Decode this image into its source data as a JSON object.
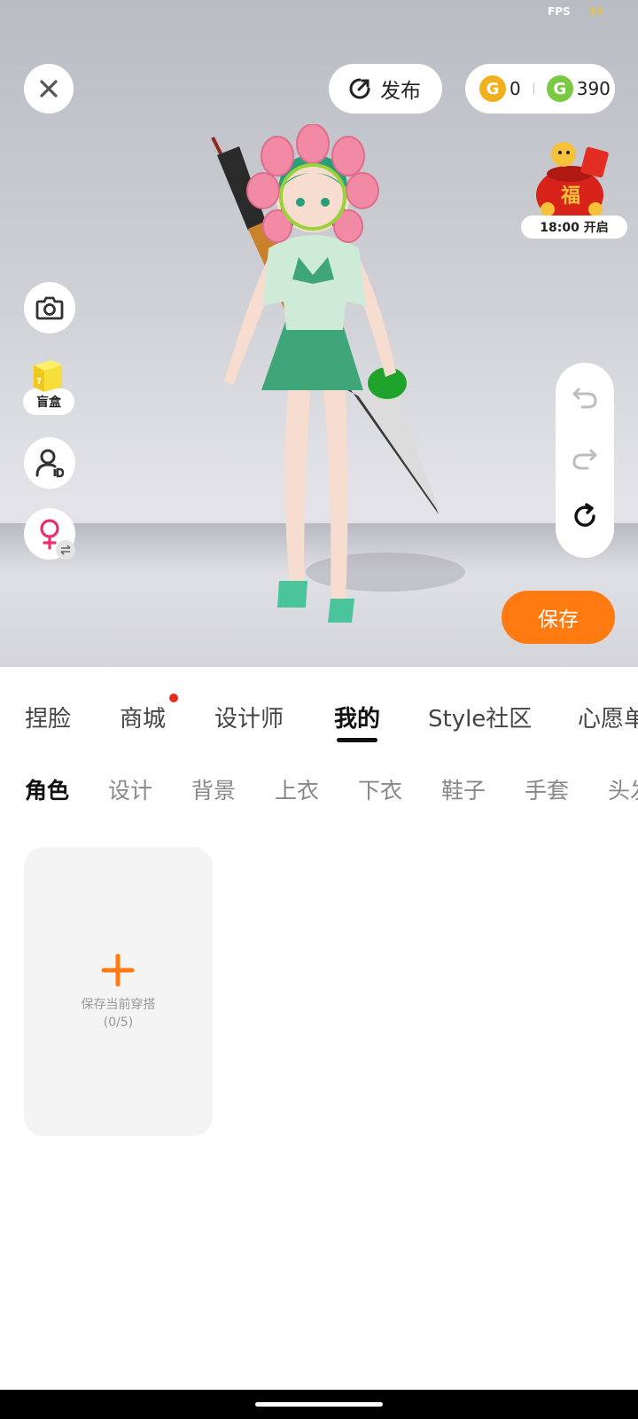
{
  "status": {
    "fps_label": "FPS",
    "fps_value": "33"
  },
  "toolbar": {
    "publish_label": "发布",
    "gold_count": "0",
    "green_count": "390",
    "redbag_time": "18:00 开启",
    "redbag_character": "福"
  },
  "left_buttons": {
    "blind_box_label": "盲盒",
    "blind_box_mark": "?"
  },
  "save_label": "保存",
  "tabs": [
    "捏脸",
    "商城",
    "设计师",
    "我的",
    "Style社区",
    "心愿单"
  ],
  "active_tab": "我的",
  "subtabs": [
    "角色",
    "设计",
    "背景",
    "上衣",
    "下衣",
    "鞋子",
    "手套",
    "头发"
  ],
  "active_subtab": "角色",
  "outfit_card": {
    "label": "保存当前穿搭",
    "count": "(0/5)"
  },
  "colors": {
    "accent": "#ff7a10",
    "notify_dot": "#e52b1d",
    "gold_coin": "#f2b01e",
    "green_coin": "#7ac943"
  }
}
